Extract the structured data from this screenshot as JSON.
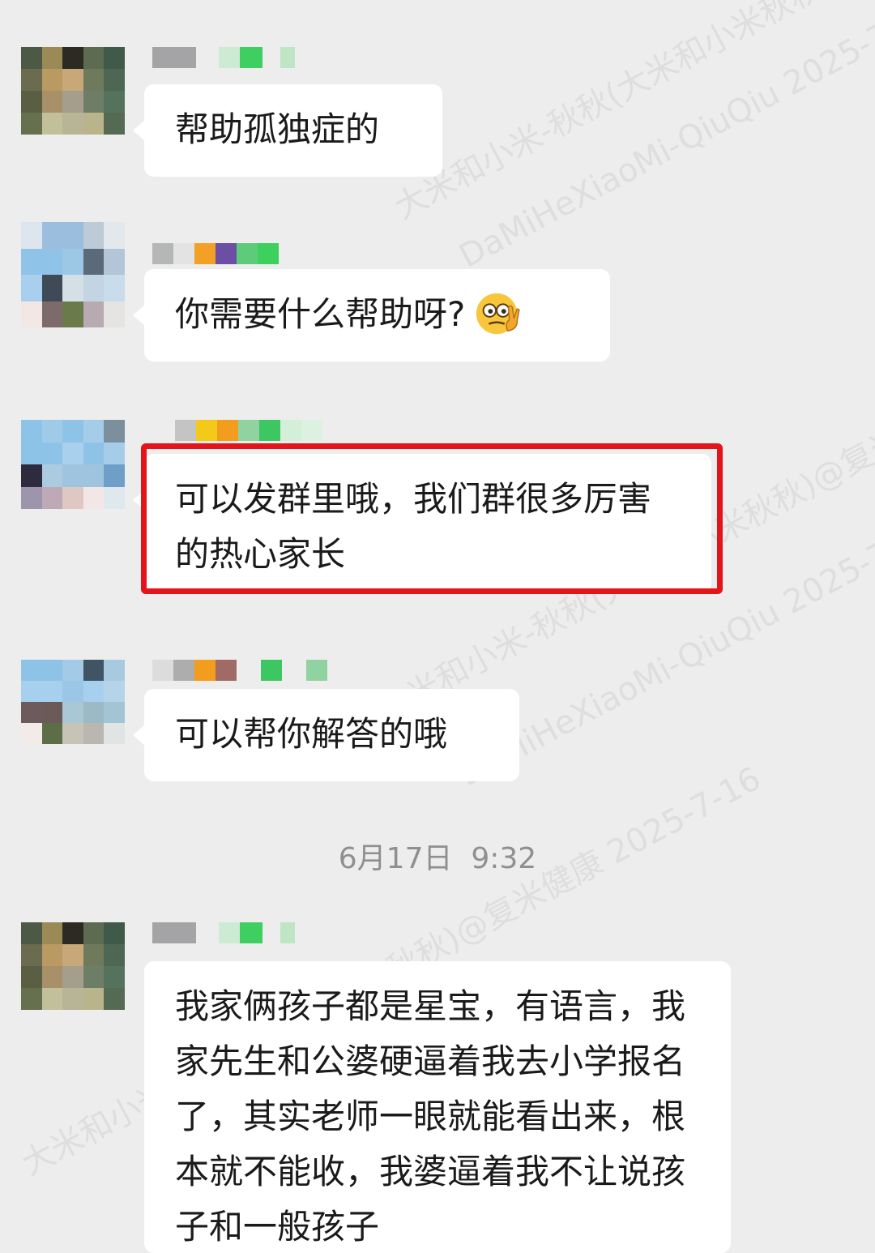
{
  "watermark": {
    "line1": "大米和小米-秋秋(大米和小米秋秋)@复米健康 2025-7-16",
    "line2": "DaMiHeXiaoMi-QiuQiu 2025-7-16"
  },
  "messages": [
    {
      "text": "帮助孤独症的",
      "avatar": "avatar-a"
    },
    {
      "text": "你需要什么帮助呀?",
      "avatar": "avatar-b",
      "emoji": "thinking-face-emoji"
    },
    {
      "text": "可以发群里哦，我们群很多厉害的热心家长",
      "avatar": "avatar-c",
      "highlighted": true,
      "highlight_color": "#e3151b"
    },
    {
      "text": "可以帮你解答的哦",
      "avatar": "avatar-d"
    },
    {
      "text": "我家俩孩子都是星宝，有语言，我家先生和公婆硬逼着我去小学报名了，其实老师一眼就能看出来，根本就不能收，我婆逼着我不让说孩子和一般孩子",
      "avatar": "avatar-a"
    }
  ],
  "timestamp": "6月17日  9:32",
  "colors": {
    "background": "#ededed",
    "bubble": "#ffffff",
    "text": "#1a1a1a",
    "timestamp": "#8f8f8f",
    "highlight_border": "#e3151b"
  }
}
